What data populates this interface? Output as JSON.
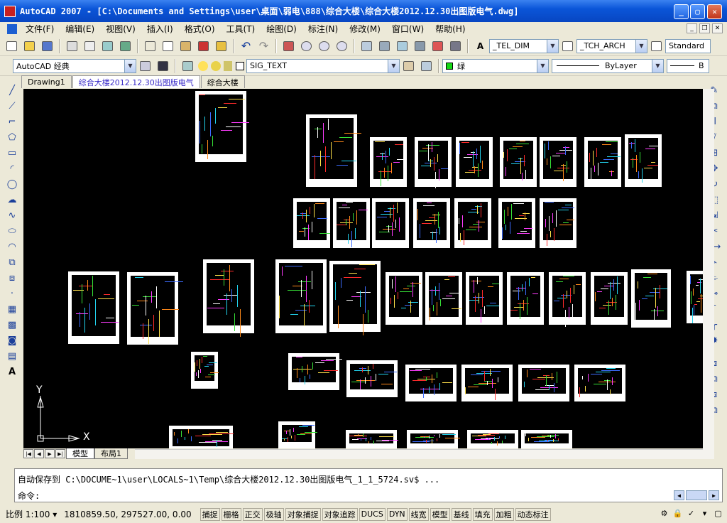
{
  "window": {
    "title": "AutoCAD 2007 - [C:\\Documents and Settings\\user\\桌面\\弱电\\888\\综合大楼\\综合大楼2012.12.30出图版电气.dwg]",
    "controls": [
      "minimize",
      "maximize",
      "close"
    ]
  },
  "menu": {
    "items": [
      "文件(F)",
      "编辑(E)",
      "视图(V)",
      "插入(I)",
      "格式(O)",
      "工具(T)",
      "绘图(D)",
      "标注(N)",
      "修改(M)",
      "窗口(W)",
      "帮助(H)"
    ]
  },
  "toolbar_styles": {
    "text_style": "_TEL_DIM",
    "dim_style": "_TCH_ARCH",
    "table_style": "Standard"
  },
  "toolbar_layers": {
    "workspace": "AutoCAD 经典",
    "layer": "SIG_TEXT",
    "color": "绿",
    "linetype": "ByLayer",
    "lineweight_partial": "B"
  },
  "doc_tabs": [
    {
      "label": "Drawing1",
      "active": false
    },
    {
      "label": "综合大楼2012.12.30出图版电气",
      "active": true
    },
    {
      "label": "综合大楼",
      "active": false
    }
  ],
  "layout_tabs": {
    "model": "模型",
    "layout1": "布局1"
  },
  "ucs": {
    "x": "X",
    "y": "Y"
  },
  "command": {
    "history": "自动保存到 C:\\DOCUME~1\\user\\LOCALS~1\\Temp\\综合大楼2012.12.30出图版电气_1_1_5724.sv$ ...",
    "prompt": "命令:"
  },
  "status": {
    "scale_label": "比例 1:100",
    "coordinates": "1810859.50, 297527.00, 0.00",
    "toggles": [
      "捕捉",
      "栅格",
      "正交",
      "极轴",
      "对象捕捉",
      "对象追踪",
      "DUCS",
      "DYN",
      "线宽",
      "模型",
      "基线",
      "填充",
      "加粗",
      "动态标注"
    ]
  },
  "colors": {
    "titlebar": "#0a55d8",
    "canvas": "#000000",
    "chrome": "#ece9d8"
  }
}
